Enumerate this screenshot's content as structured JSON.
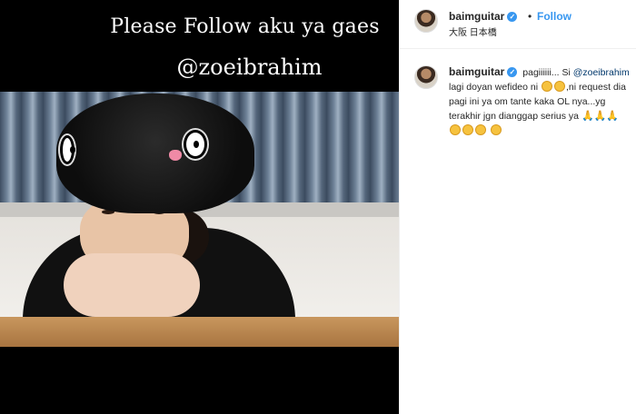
{
  "media": {
    "overlay_line1": "Please Follow aku ya gaes",
    "overlay_line2": "@zoeibrahim"
  },
  "header": {
    "username": "baimguitar",
    "dot": "•",
    "follow_label": "Follow",
    "location": "大阪 日本橋"
  },
  "caption": {
    "username": "baimguitar",
    "text_1": "pagiiiiii... Si",
    "mention": "@zoeibrahim",
    "text_2": "lagi doyan wefideo ni",
    "text_3": ",ni request dia pagi ini ya om tante kaka OL nya...yg terakhir jgn dianggap serius ya",
    "pray": "🙏"
  },
  "colors": {
    "link": "#3897f0",
    "mention": "#00376b",
    "text": "#262626"
  }
}
